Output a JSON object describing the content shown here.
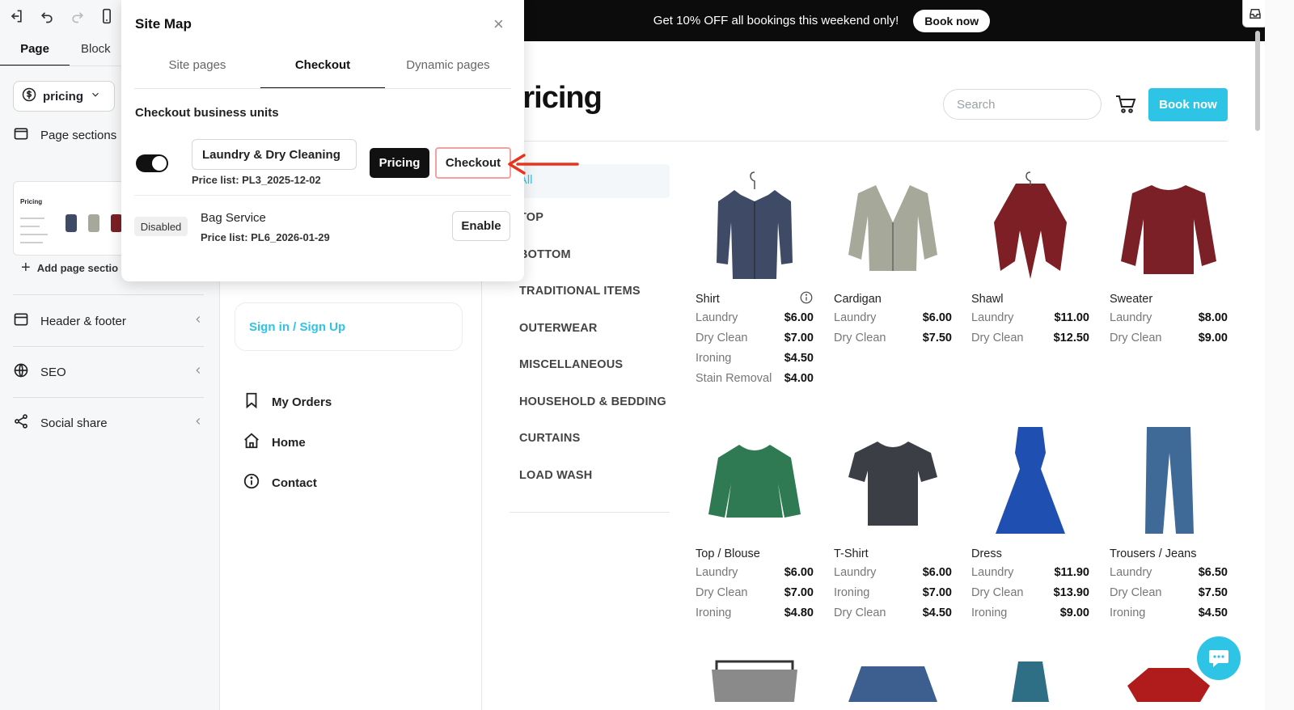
{
  "editor": {
    "tabs": [
      "Page",
      "Block"
    ],
    "page_selector": {
      "value": "pricing"
    },
    "sections": {
      "page_sections_label": "Page sections",
      "thumb_title": "Pricing",
      "add_section_label": "Add page sectio"
    },
    "panels": [
      {
        "label": "Header & footer",
        "icon": "layout-icon"
      },
      {
        "label": "SEO",
        "icon": "globe-icon"
      },
      {
        "label": "Social share",
        "icon": "share-icon"
      }
    ]
  },
  "sitemap": {
    "title": "Site Map",
    "tabs": [
      "Site pages",
      "Checkout",
      "Dynamic pages"
    ],
    "active_tab": "Checkout",
    "subtitle": "Checkout business units",
    "units": [
      {
        "name": "Laundry & Dry Cleaning",
        "price_list": "Price list: PL3_2025-12-02",
        "enabled": true,
        "buttons": [
          "Pricing",
          "Checkout"
        ]
      },
      {
        "name": "Bag Service",
        "price_list": "Price list: PL6_2026-01-29",
        "status": "Disabled",
        "button": "Enable"
      }
    ]
  },
  "site": {
    "promo": {
      "text": "Get 10% OFF all bookings this weekend only!",
      "button": "Book now"
    },
    "title": "Pricing",
    "search_placeholder": "Search",
    "book_now": "Book now",
    "sign_in": "Sign in / Sign Up",
    "menu": [
      {
        "label": "My Orders",
        "icon": "bookmark-icon"
      },
      {
        "label": "Home",
        "icon": "home-icon"
      },
      {
        "label": "Contact",
        "icon": "info-icon"
      }
    ],
    "categories": [
      "All",
      "TOP",
      "BOTTOM",
      "TRADITIONAL ITEMS",
      "OUTERWEAR",
      "MISCELLANEOUS",
      "HOUSEHOLD & BEDDING",
      "CURTAINS",
      "LOAD WASH"
    ],
    "active_category": "All",
    "products": [
      {
        "name": "Shirt",
        "color": "#3f4a66",
        "prices": [
          [
            "Laundry",
            "$6.00"
          ],
          [
            "Dry Clean",
            "$7.00"
          ],
          [
            "Ironing",
            "$4.50"
          ],
          [
            "Stain Removal",
            "$4.00"
          ]
        ]
      },
      {
        "name": "Cardigan",
        "color": "#a6a99a",
        "prices": [
          [
            "Laundry",
            "$6.00"
          ],
          [
            "Dry Clean",
            "$7.50"
          ]
        ]
      },
      {
        "name": "Shawl",
        "color": "#7d1f24",
        "prices": [
          [
            "Laundry",
            "$11.00"
          ],
          [
            "Dry Clean",
            "$12.50"
          ]
        ]
      },
      {
        "name": "Sweater",
        "color": "#7a2026",
        "prices": [
          [
            "Laundry",
            "$8.00"
          ],
          [
            "Dry Clean",
            "$9.00"
          ]
        ]
      },
      {
        "name": "Top / Blouse",
        "color": "#2f7a52",
        "prices": [
          [
            "Laundry",
            "$6.00"
          ],
          [
            "Dry Clean",
            "$7.00"
          ],
          [
            "Ironing",
            "$4.80"
          ]
        ]
      },
      {
        "name": "T-Shirt",
        "color": "#3b3f45",
        "prices": [
          [
            "Laundry",
            "$6.00"
          ],
          [
            "Ironing",
            "$7.00"
          ],
          [
            "Dry Clean",
            "$4.50"
          ]
        ]
      },
      {
        "name": "Dress",
        "color": "#1f4fb0",
        "prices": [
          [
            "Laundry",
            "$11.90"
          ],
          [
            "Dry Clean",
            "$13.90"
          ],
          [
            "Ironing",
            "$9.00"
          ]
        ]
      },
      {
        "name": "Trousers / Jeans",
        "color": "#3f6a98",
        "prices": [
          [
            "Laundry",
            "$6.50"
          ],
          [
            "Dry Clean",
            "$7.50"
          ],
          [
            "Ironing",
            "$4.50"
          ]
        ]
      }
    ],
    "partial_products": [
      {
        "color": "#8a8a8a"
      },
      {
        "color": "#3d5f8f"
      },
      {
        "color": "#2f6f86"
      },
      {
        "color": "#b01c1c"
      }
    ]
  },
  "colors": {
    "accent": "#2ec4e6",
    "annotation_arrow": "#e8341c",
    "checkout_highlight": "#f2a1a0"
  }
}
